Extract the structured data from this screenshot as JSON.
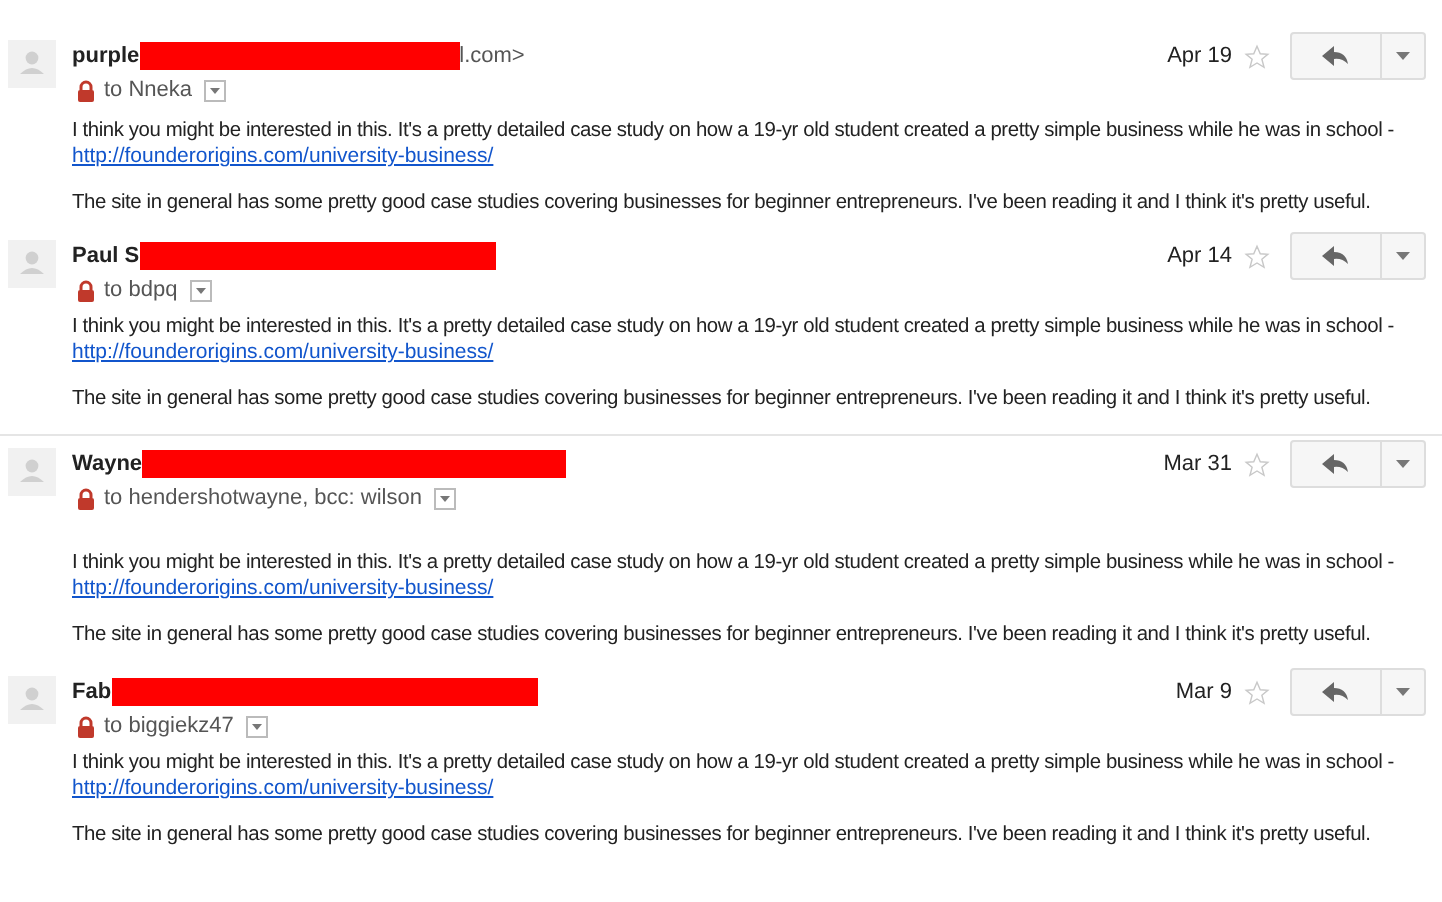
{
  "messages": [
    {
      "sender": "purple",
      "sender_tail": "l.com>",
      "recipients": "to Nneka",
      "date": "Apr 19",
      "starred": false,
      "body": "I think you might be interested in this. It's a pretty detailed case study on how a 19-yr old student created a pretty simple business while he was in school -",
      "link": "http://founderorigins.com/university-business/",
      "body_2": "The site in general has some pretty good case studies covering businesses for beginner entrepreneurs. I've been reading it and I think it's pretty useful."
    },
    {
      "sender": "Paul S",
      "recipients": "to bdpq",
      "date": "Apr 14",
      "starred": false,
      "body": "I think you might be interested in this. It's a pretty detailed case study on how a 19-yr old student created a pretty simple business while he was in school -",
      "link": "http://founderorigins.com/university-business/",
      "body_2": "The site in general has some pretty good case studies covering businesses for beginner entrepreneurs. I've been reading it and I think it's pretty useful."
    },
    {
      "sender": "Wayne",
      "recipients": "to hendershotwayne, bcc: wilson",
      "date": "Mar 31",
      "starred": false,
      "body": "I think you might be interested in this. It's a pretty detailed case study on how a 19-yr old student created a pretty simple business while he was in school -",
      "link": "http://founderorigins.com/university-business/",
      "body_2": "The site in general has some pretty good case studies covering businesses for beginner entrepreneurs. I've been reading it and I think it's pretty useful."
    },
    {
      "sender": "Fab",
      "recipients": "to biggiekz47",
      "date": "Mar 9",
      "starred": false,
      "body": "I think you might be interested in this. It's a pretty detailed case study on how a 19-yr old student created a pretty simple business while he was in school -",
      "link": "http://founderorigins.com/university-business/",
      "body_2": "The site in general has some pretty good case studies covering businesses for beginner entrepreneurs. I've been reading it and I think it's pretty useful."
    }
  ]
}
